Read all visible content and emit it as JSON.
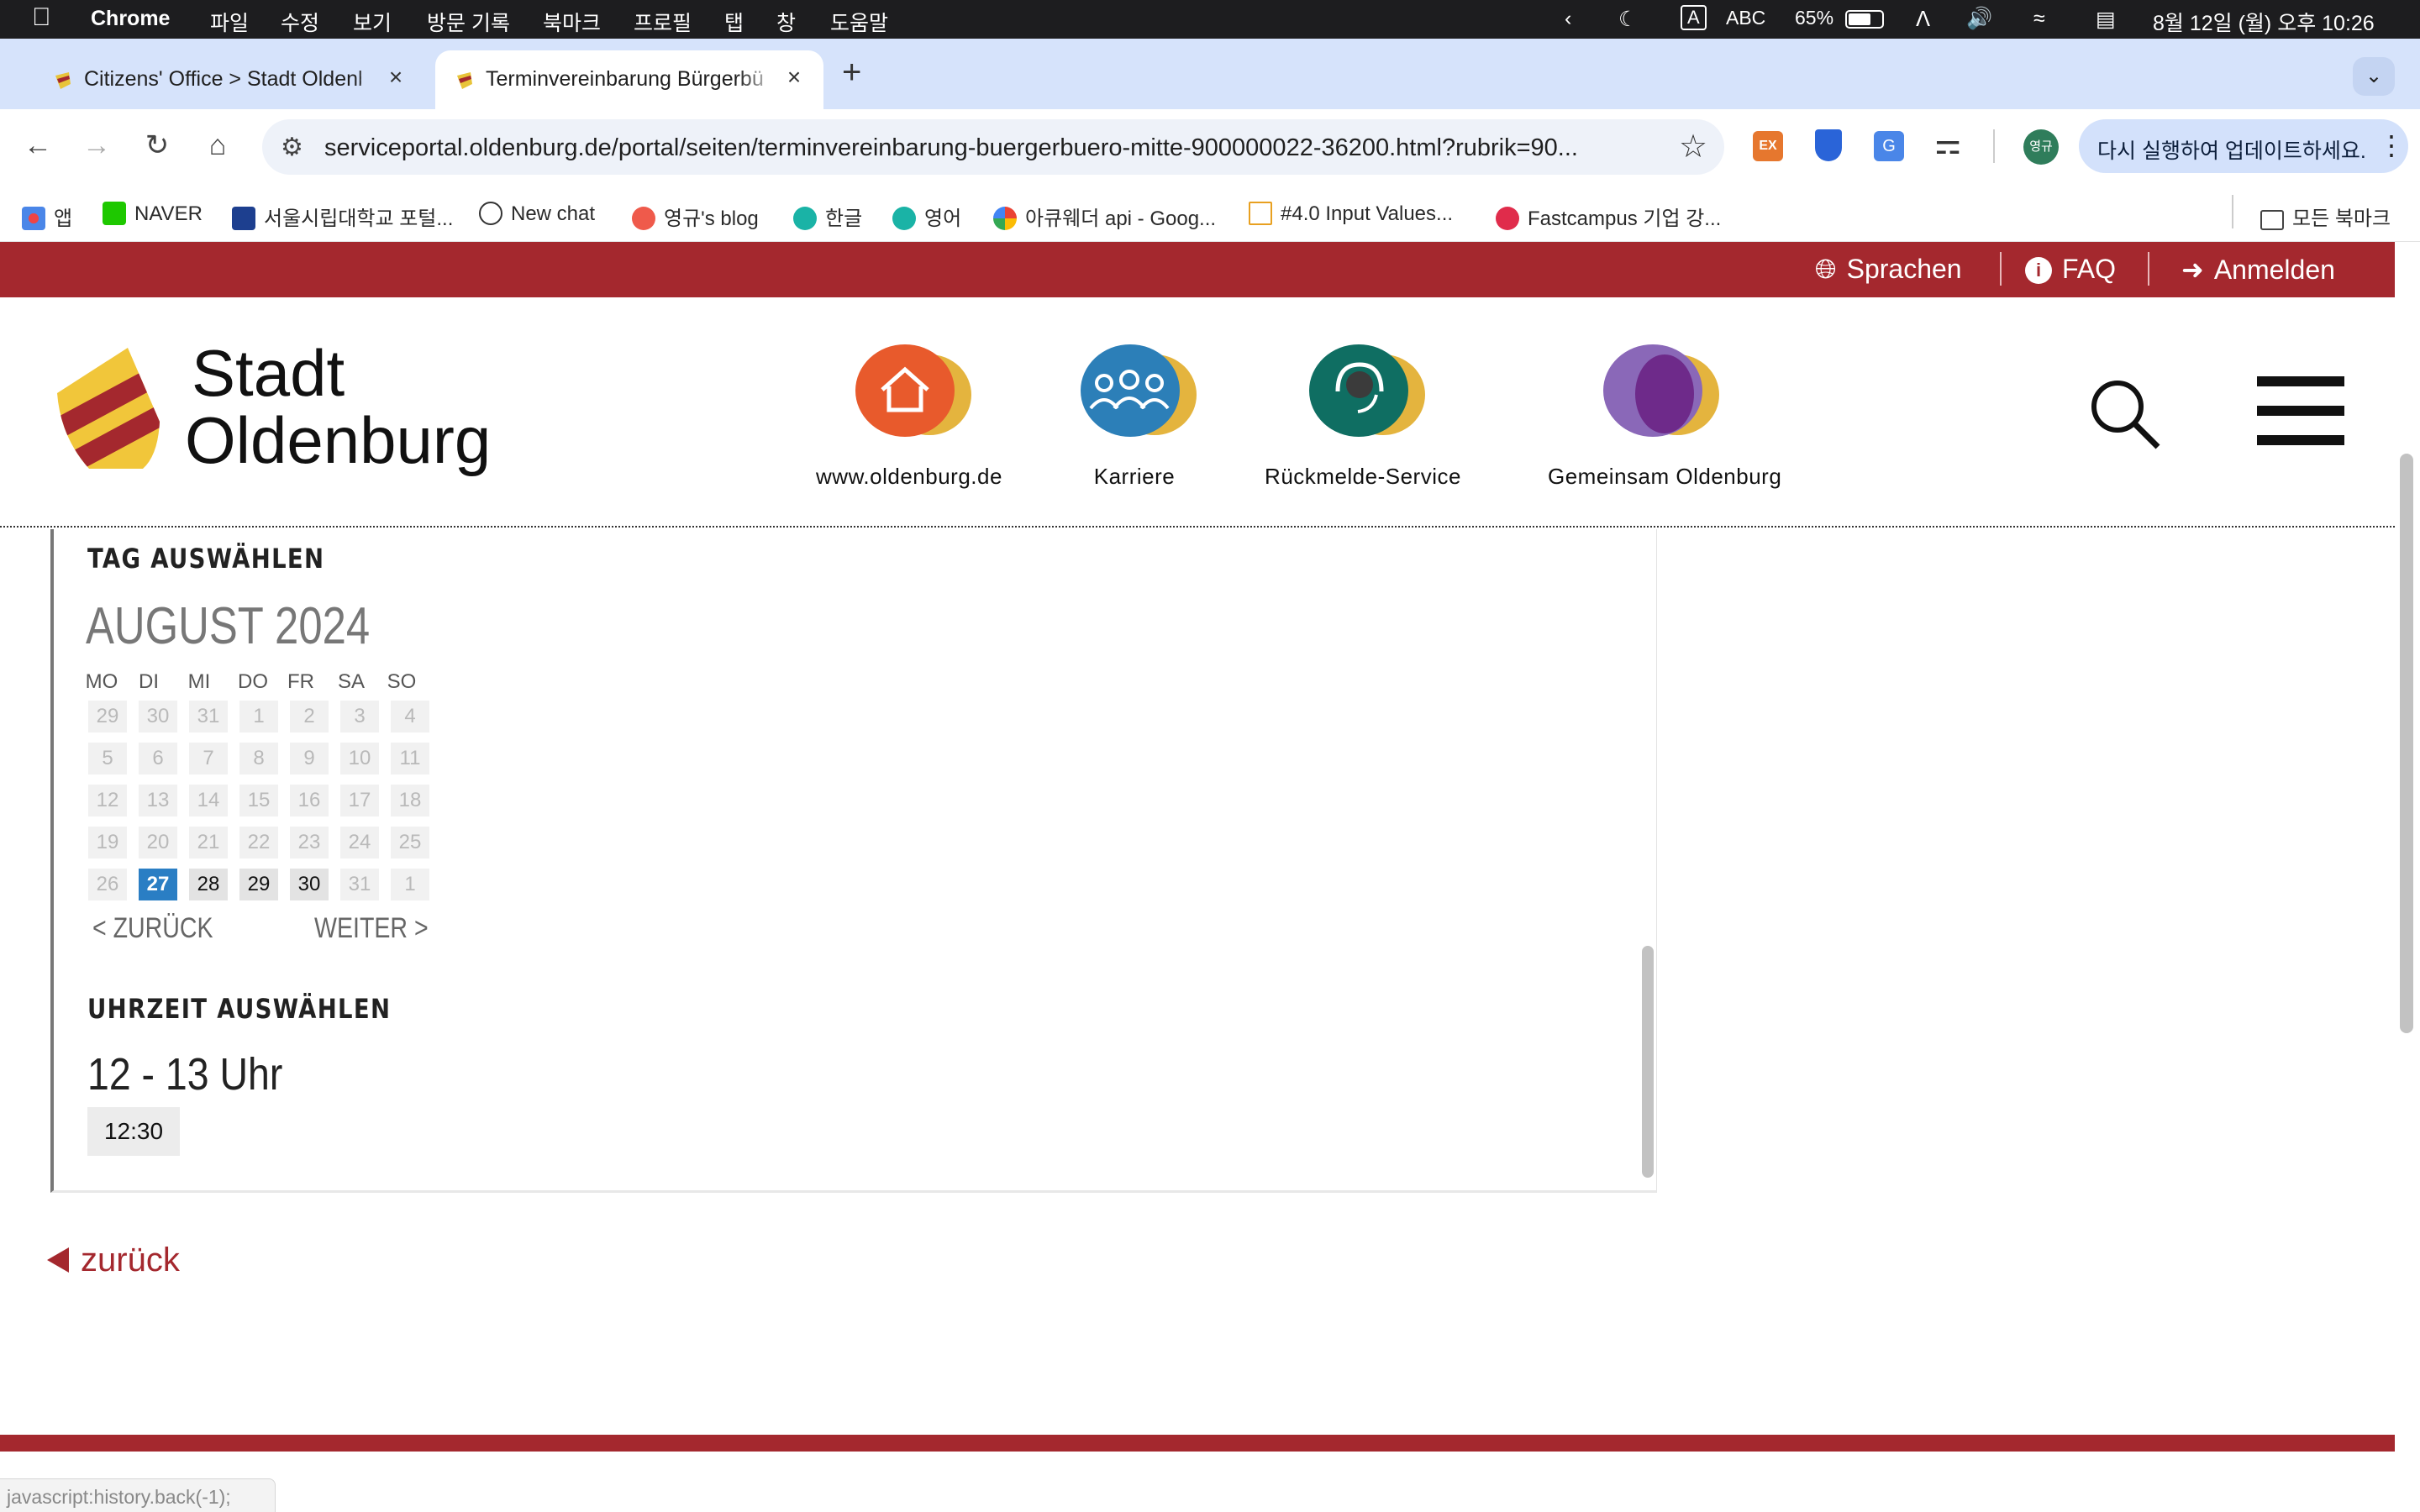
{
  "menubar": {
    "app": "Chrome",
    "items": [
      "파일",
      "수정",
      "보기",
      "방문 기록",
      "북마크",
      "프로필",
      "탭",
      "창",
      "도움말"
    ],
    "input_indicator": "A",
    "input_source": "ABC",
    "battery": "65%",
    "clock": "8월 12일 (월) 오후 10:26"
  },
  "tabs": [
    {
      "title": "Citizens' Office > Stadt Oldenburg"
    },
    {
      "title": "Terminvereinbarung Bürgerbüro"
    }
  ],
  "toolbar": {
    "url": "serviceportal.oldenburg.de/portal/seiten/terminvereinbarung-buergerbuero-mitte-900000022-36200.html?rubrik=90...",
    "update_label": "다시 실행하여 업데이트하세요.",
    "profile": "영규",
    "ext_ex": "EX"
  },
  "bookmarks": {
    "items": [
      "앱",
      "NAVER",
      "서울시립대학교 포털...",
      "New chat",
      "영규's blog",
      "한글",
      "영어",
      "아큐웨더 api - Goog...",
      "#4.0 Input Values...",
      "Fastcampus 기업 강..."
    ],
    "all_label": "모든 북마크"
  },
  "topbar": {
    "languages": "Sprachen",
    "faq": "FAQ",
    "login": "Anmelden"
  },
  "header": {
    "logo_line1": "Stadt",
    "logo_line2": "Oldenburg",
    "nav": [
      {
        "label": "www.oldenburg.de",
        "color": "#e85a2c"
      },
      {
        "label": "Karriere",
        "color": "#2c7fb8"
      },
      {
        "label": "Rückmelde-Service",
        "color": "#0f6e62"
      },
      {
        "label": "Gemeinsam Oldenburg",
        "color": "#7b3fa1"
      }
    ]
  },
  "calendar": {
    "heading": "TAG AUSWÄHLEN",
    "month": "AUGUST 2024",
    "weekdays": [
      "MO",
      "DI",
      "MI",
      "DO",
      "FR",
      "SA",
      "SO"
    ],
    "weeks": [
      [
        "29",
        "30",
        "31",
        "1",
        "2",
        "3",
        "4"
      ],
      [
        "5",
        "6",
        "7",
        "8",
        "9",
        "10",
        "11"
      ],
      [
        "12",
        "13",
        "14",
        "15",
        "16",
        "17",
        "18"
      ],
      [
        "19",
        "20",
        "21",
        "22",
        "23",
        "24",
        "25"
      ],
      [
        "26",
        "27",
        "28",
        "29",
        "30",
        "31",
        "1"
      ]
    ],
    "selected": "27",
    "available": [
      "28",
      "29",
      "30"
    ],
    "prev_label": "< ZURÜCK",
    "next_label": "WEITER >"
  },
  "time": {
    "heading": "UHRZEIT AUSWÄHLEN",
    "range": "12 - 13 Uhr",
    "slot": "12:30"
  },
  "back_label": "zurück",
  "status_text": "javascript:history.back(-1);"
}
